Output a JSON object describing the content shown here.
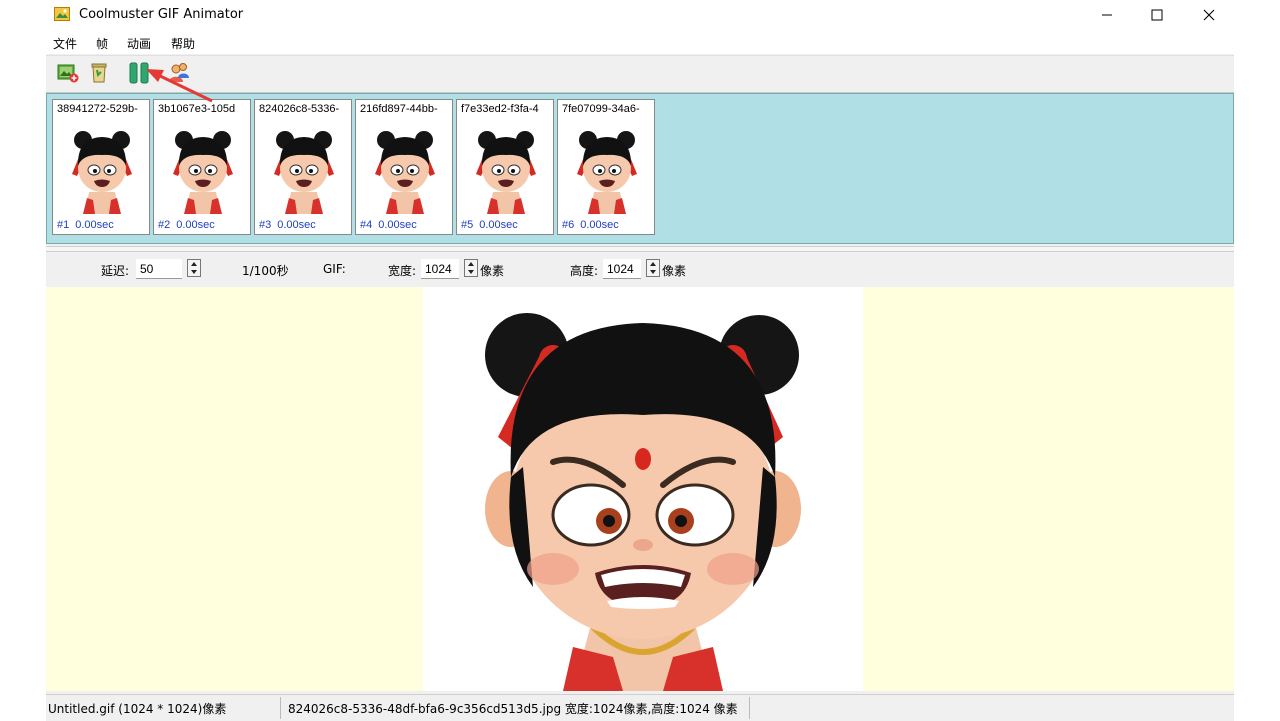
{
  "window": {
    "title": "Coolmuster GIF Animator",
    "controls": {
      "minimize": "minimize",
      "maximize": "maximize",
      "close": "close"
    }
  },
  "menu": [
    {
      "label": "文件"
    },
    {
      "label": "帧"
    },
    {
      "label": "动画"
    },
    {
      "label": "帮助"
    }
  ],
  "toolbar": {
    "buttons": [
      {
        "icon": "add-image-icon"
      },
      {
        "icon": "trash-icon"
      },
      {
        "icon": "pause-icon"
      },
      {
        "icon": "users-icon"
      }
    ],
    "annotation_color": "#e53935"
  },
  "frames": [
    {
      "name": "38941272-529b-",
      "index": "#1",
      "delay": "0.00sec"
    },
    {
      "name": "3b1067e3-105d",
      "index": "#2",
      "delay": "0.00sec"
    },
    {
      "name": "824026c8-5336-",
      "index": "#3",
      "delay": "0.00sec"
    },
    {
      "name": "216fd897-44bb-",
      "index": "#4",
      "delay": "0.00sec"
    },
    {
      "name": "f7e33ed2-f3fa-4",
      "index": "#5",
      "delay": "0.00sec"
    },
    {
      "name": "7fe07099-34a6-",
      "index": "#6",
      "delay": "0.00sec"
    }
  ],
  "params": {
    "delay_label": "延迟:",
    "delay_value": "50",
    "delay_unit": "1/100秒",
    "gif_label": "GIF:",
    "width_label": "宽度:",
    "width_value": "1024",
    "width_unit": "像素",
    "height_label": "高度:",
    "height_value": "1024",
    "height_unit": "像素"
  },
  "status": {
    "file": "Untitled.gif (1024 * 1024)像素",
    "frame_info": "824026c8-5336-48df-bfa6-9c356cd513d5.jpg 宽度:1024像素,高度:1024 像素"
  },
  "colors": {
    "frames_panel": "#b0dfe5",
    "preview_bg": "#ffffde",
    "frame_label": "#1f3fbf"
  }
}
